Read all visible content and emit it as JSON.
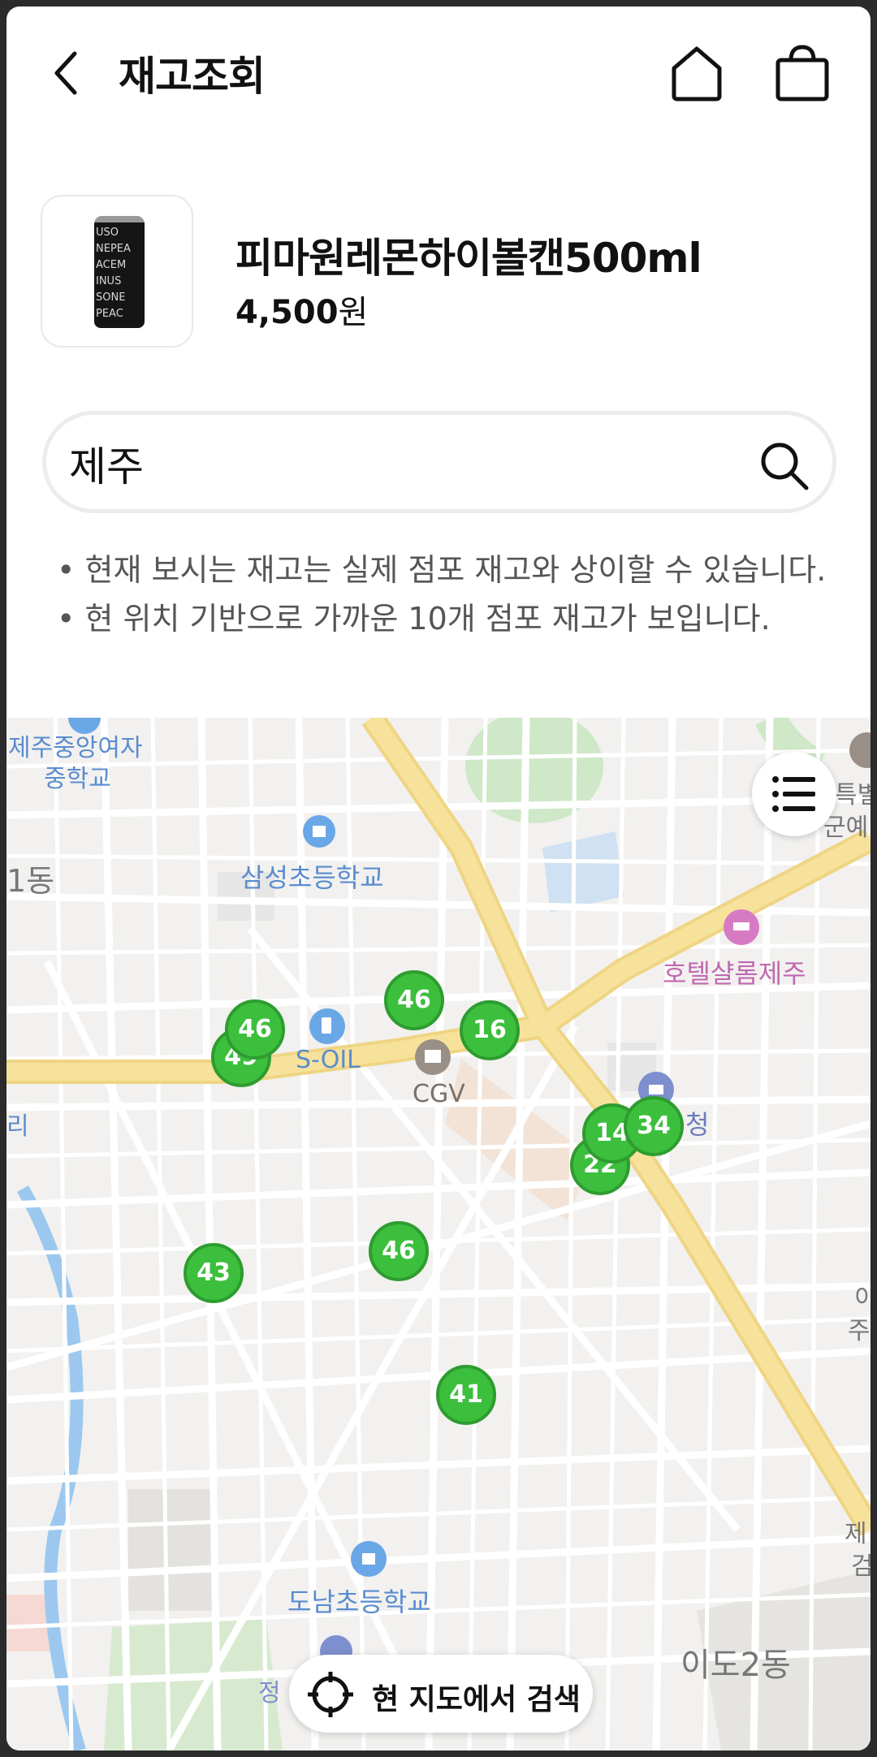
{
  "header": {
    "title": "재고조회"
  },
  "product": {
    "name": "피마원레몬하이볼캔500ml",
    "price": "4,500",
    "price_unit": "원",
    "can_lines": [
      "USO",
      "NEPEA",
      "ACEM",
      "INUS",
      "SONE",
      "PEAC"
    ]
  },
  "search": {
    "value": "제주"
  },
  "notes": {
    "line1": "• 현재 보시는 재고는 실제 점포 재고와 상이할 수 있습니다.",
    "line2": "• 현 위치 기반으로 가까운 10개 점포 재고가 보입니다."
  },
  "map": {
    "labels": {
      "school1": "제주중앙여자",
      "school1b": "중학교",
      "dong1": "1동",
      "samsung": "삼성초등학교",
      "hotel": "호텔샬롬제주",
      "soil": "S-OIL",
      "cgv": "CGV",
      "cheong": "청",
      "donam": "도남초등학교",
      "ido": "이도2동",
      "ri": "리",
      "teuk": "특별",
      "gun": "군예",
      "jeong": "정",
      "jeju_right": "제",
      "geom": "검",
      "ijeu": "이",
      "ju": "주"
    },
    "markers": [
      {
        "count": "46"
      },
      {
        "count": "49"
      },
      {
        "count": "46"
      },
      {
        "count": "16"
      },
      {
        "count": "22"
      },
      {
        "count": "14"
      },
      {
        "count": "34"
      },
      {
        "count": "46"
      },
      {
        "count": "43"
      },
      {
        "count": "41"
      }
    ],
    "search_here_label": "현 지도에서 검색"
  },
  "colors": {
    "marker": "#3cbf3c",
    "main_road": "#f7dd8a",
    "water": "#9cc8ef",
    "map_bg": "#f2f1ef"
  }
}
